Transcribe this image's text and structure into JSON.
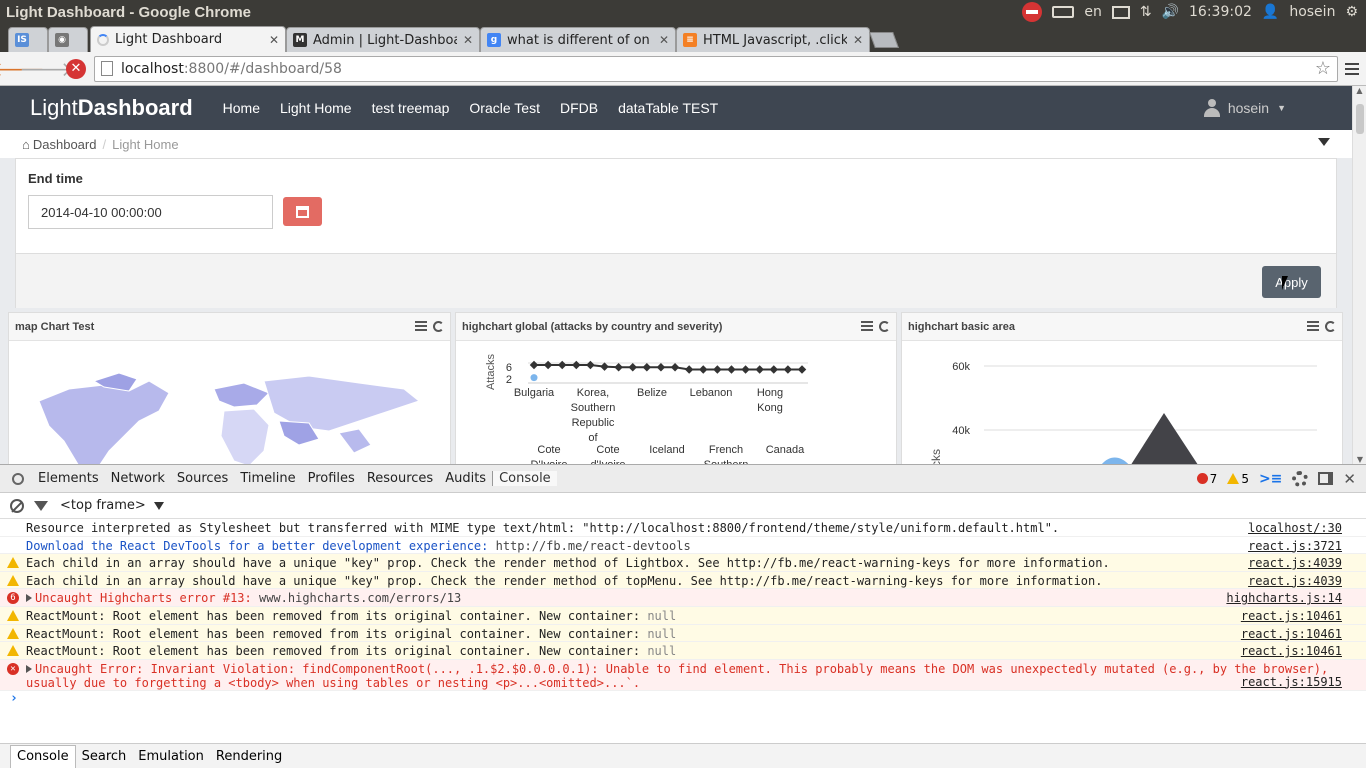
{
  "window": {
    "title": "Light Dashboard - Google Chrome",
    "tray": {
      "lang": "en",
      "time": "16:39:02",
      "user": "hosein"
    }
  },
  "tabs": [
    {
      "label": "",
      "favicon": "IS",
      "favicon_color": "#5a8fd8"
    },
    {
      "label": "",
      "favicon": "owl",
      "favicon_color": "#777777"
    },
    {
      "label": "Light Dashboard",
      "favicon": "loading",
      "favicon_color": "#ffffff",
      "active": true
    },
    {
      "label": "Admin | Light-Dashboard",
      "favicon": "M",
      "favicon_color": "#333333"
    },
    {
      "label": "what is different of on cli",
      "favicon": "g",
      "favicon_color": "#4285f4"
    },
    {
      "label": "HTML Javascript, .click()-:",
      "favicon": "so",
      "favicon_color": "#f48024"
    }
  ],
  "address": {
    "host": "localhost",
    "path": ":8800/#/dashboard/58"
  },
  "app": {
    "brand_light": "Light",
    "brand_bold": "Dashboard",
    "nav": [
      "Home",
      "Light Home",
      "test treemap",
      "Oracle Test",
      "DFDB",
      "dataTable TEST"
    ],
    "user": "hosein",
    "breadcrumb": {
      "home": "Dashboard",
      "current": "Light Home"
    },
    "filter": {
      "label": "End time",
      "value": "2014-04-10 00:00:00",
      "apply": "Apply"
    }
  },
  "widgets": [
    {
      "title": "map Chart Test"
    },
    {
      "title": "highchart global (attacks by country and severity)"
    },
    {
      "title": "highchart basic area"
    }
  ],
  "chart_data": [
    {
      "type": "line",
      "ylabel": "Attacks",
      "y_ticks": [
        "6",
        "2"
      ],
      "x_labels_row1": [
        "Bulgaria",
        "Korea, Southern Republic of",
        "Belize",
        "Lebanon",
        "Hong Kong"
      ],
      "x_labels_row2": [
        "Cote D'Ivoire",
        "Cote d'Ivoire",
        "Iceland",
        "French Southern",
        "Canada"
      ],
      "values": [
        7,
        7,
        7,
        7,
        7,
        6.4,
        6.2,
        6.2,
        6.2,
        6.2,
        6.2,
        5.4,
        5.4,
        5.4,
        5.4,
        5.4,
        5.4,
        5.4,
        5.4,
        5.4
      ],
      "second_series_first_point": 2.5,
      "ylim": [
        2,
        7
      ]
    },
    {
      "type": "area",
      "ylabel": "Stacks",
      "y_ticks": [
        "60k",
        "40k"
      ],
      "ylim": [
        0,
        60000
      ]
    }
  ],
  "devtools": {
    "tabs": [
      "Elements",
      "Network",
      "Sources",
      "Timeline",
      "Profiles",
      "Resources",
      "Audits",
      "Console"
    ],
    "errors": "7",
    "warnings": "5",
    "frame": "<top frame>",
    "lines": [
      {
        "kind": "info",
        "text_a": "Resource interpreted as Stylesheet but transferred with MIME type text/html: \"",
        "link": "http://localhost:8800/frontend/theme/style/uniform.default.html",
        "text_b": "\".",
        "src": "localhost/:30"
      },
      {
        "kind": "blue",
        "text_a": "Download the React DevTools for a better development experience: ",
        "link": "http://fb.me/react-devtools",
        "text_b": "",
        "src": "react.js:3721"
      },
      {
        "kind": "warn",
        "text_a": "Each child in an array should have a unique \"key\" prop. Check the render method of Lightbox. See http://fb.me/react-warning-keys for more information.",
        "src": "react.js:4039"
      },
      {
        "kind": "warn",
        "text_a": "Each child in an array should have a unique \"key\" prop. Check the render method of topMenu. See http://fb.me/react-warning-keys for more information.",
        "src": "react.js:4039"
      },
      {
        "kind": "err",
        "count": "6",
        "text_a": "Uncaught Highcharts error #13: ",
        "link": "www.highcharts.com/errors/13",
        "src": "highcharts.js:14"
      },
      {
        "kind": "warn",
        "text_a": "ReactMount: Root element has been removed from its original container. New container: ",
        "nulltext": "null",
        "src": "react.js:10461"
      },
      {
        "kind": "warn",
        "text_a": "ReactMount: Root element has been removed from its original container. New container: ",
        "nulltext": "null",
        "src": "react.js:10461"
      },
      {
        "kind": "warn",
        "text_a": "ReactMount: Root element has been removed from its original container. New container: ",
        "nulltext": "null",
        "src": "react.js:10461"
      },
      {
        "kind": "err2",
        "text_a": "Uncaught Error: Invariant Violation: findComponentRoot(..., .1.$2.$0.0.0.0.1): Unable to find element. This probably means the DOM was unexpectedly mutated (e.g., by the browser),",
        "text_b": "usually due to forgetting a <tbody> when using tables or nesting <p>...<omitted>...`.",
        "src": "react.js:15915"
      }
    ],
    "drawer": [
      "Console",
      "Search",
      "Emulation",
      "Rendering"
    ]
  }
}
